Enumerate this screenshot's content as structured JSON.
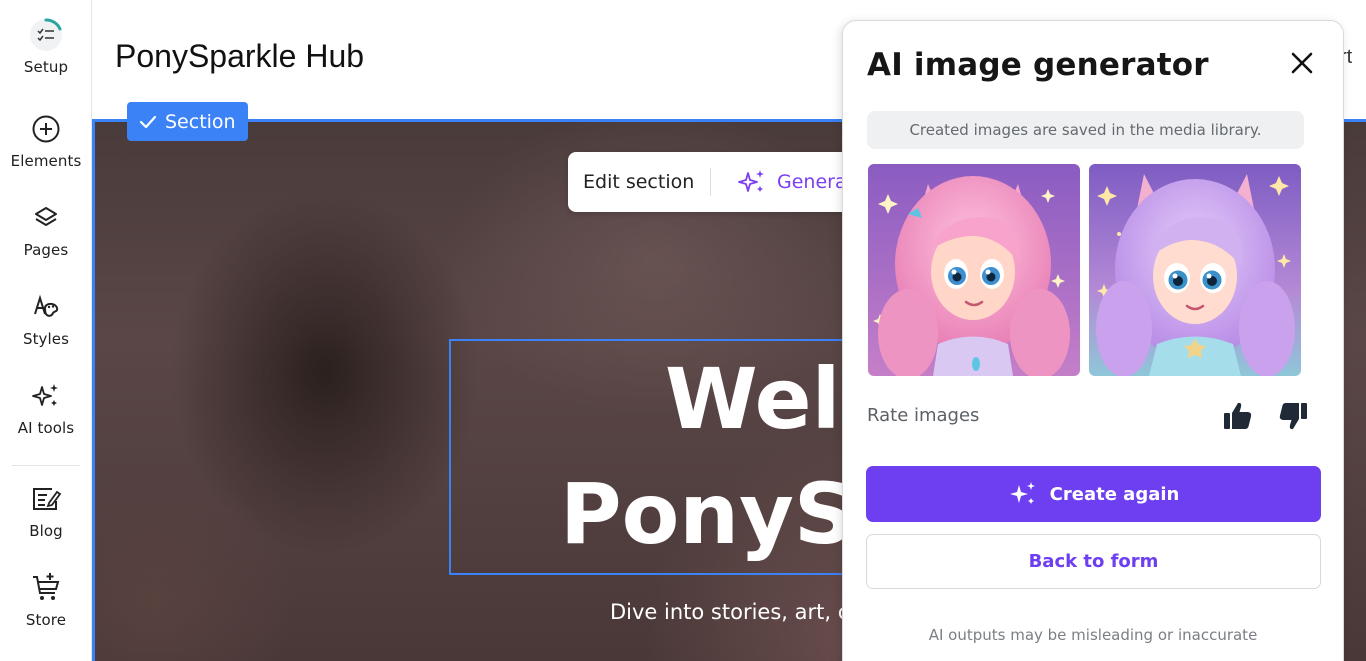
{
  "sidebar": {
    "items": [
      {
        "label": "Setup",
        "icon": "setup-checklist-icon"
      },
      {
        "label": "Elements",
        "icon": "plus-circle-icon"
      },
      {
        "label": "Pages",
        "icon": "layers-icon"
      },
      {
        "label": "Styles",
        "icon": "palette-icon"
      },
      {
        "label": "AI tools",
        "icon": "sparkles-icon"
      },
      {
        "label": "Blog",
        "icon": "blog-edit-icon"
      },
      {
        "label": "Store",
        "icon": "cart-plus-icon"
      }
    ]
  },
  "header": {
    "site_title": "PonySparkle Hub",
    "right_fragment": "rt"
  },
  "canvas": {
    "section_badge": "Section",
    "edit_section": "Edit section",
    "generate_label": "Genera",
    "hero_line1": "Welc",
    "hero_line2": "PonyS",
    "hero_subtitle": "Dive into stories, art, c"
  },
  "panel": {
    "title": "AI image generator",
    "info": "Created images are saved in the media library.",
    "rate_label": "Rate images",
    "create_again": "Create again",
    "back_to_form": "Back to form",
    "disclaimer": "AI outputs may be misleading or inaccurate"
  },
  "colors": {
    "accent_purple": "#6d3ff0",
    "selection_blue": "#3b82f6"
  }
}
